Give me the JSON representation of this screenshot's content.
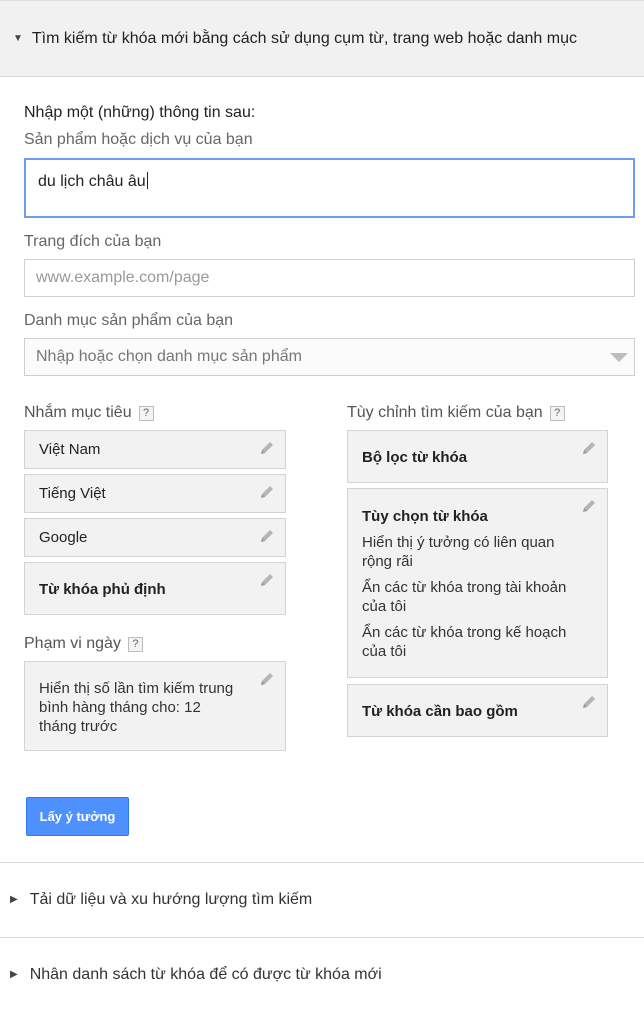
{
  "sections": {
    "open_title": "Tìm kiếm từ khóa mới bằng cách sử dụng cụm từ, trang web hoặc danh mục",
    "closed_1": "Tải dữ liệu và xu hướng lượng tìm kiếm",
    "closed_2": "Nhân danh sách từ khóa để có được từ khóa mới"
  },
  "form": {
    "intro": "Nhập một (những) thông tin sau:",
    "product_label": "Sản phẩm hoặc dịch vụ của bạn",
    "product_value": "du lịch châu âu",
    "landing_label": "Trang đích của bạn",
    "landing_placeholder": "www.example.com/page",
    "category_label": "Danh mục sản phẩm của bạn",
    "category_placeholder": "Nhập hoặc chọn danh mục sản phẩm"
  },
  "targeting": {
    "heading": "Nhắm mục tiêu",
    "help": "?",
    "location": "Việt Nam",
    "language": "Tiếng Việt",
    "network": "Google",
    "negative_keywords": "Từ khóa phủ định"
  },
  "date_range": {
    "heading": "Phạm vi ngày",
    "help": "?",
    "line1": "Hiển thị số lần tìm kiếm trung",
    "line2": "bình hàng tháng cho: 12",
    "line3": "tháng trước"
  },
  "customize": {
    "heading": "Tùy chỉnh tìm kiếm của bạn",
    "help": "?",
    "keyword_filters": "Bộ lọc từ khóa",
    "keyword_options": {
      "title": "Tùy chọn từ khóa",
      "opt1_l1": "Hiển thị ý tưởng có liên quan",
      "opt1_l2": "rộng rãi",
      "opt2_l1": "Ẩn các từ khóa trong tài khoản",
      "opt2_l2": "của tôi",
      "opt3_l1": "Ẩn các từ khóa trong kế hoạch",
      "opt3_l2": "của tôi"
    },
    "keywords_to_include": "Từ khóa cần bao gồm"
  },
  "actions": {
    "get_ideas": "Lấy ý tưởng"
  }
}
